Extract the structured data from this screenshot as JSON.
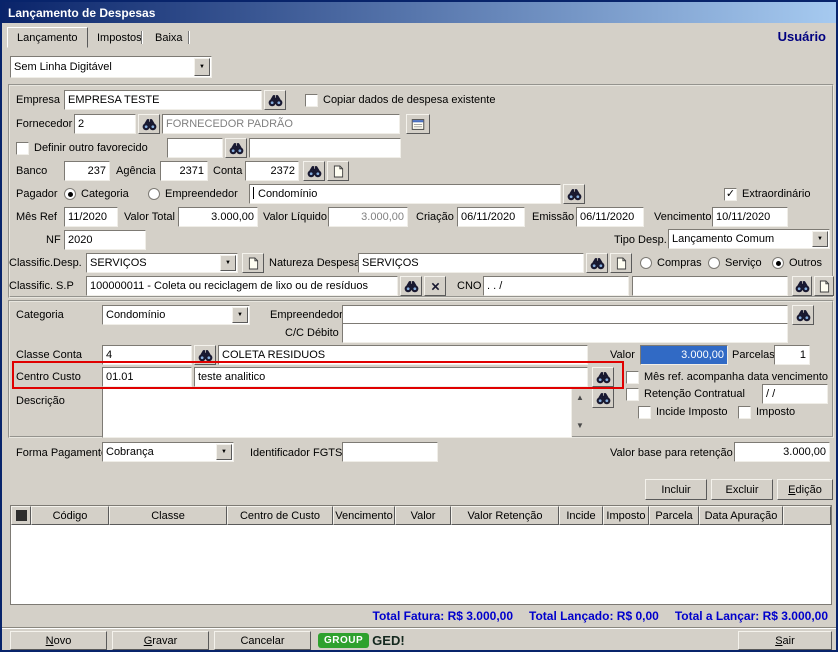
{
  "window": {
    "title": "Lançamento de Despesas",
    "user": "Usuário"
  },
  "tabs": {
    "items": [
      {
        "label": "Lançamento",
        "active": true
      },
      {
        "label": "Impostos",
        "active": false
      },
      {
        "label": "Baixa",
        "active": false
      }
    ]
  },
  "toolbar": {
    "linha_digitavel": "Sem Linha Digitável"
  },
  "form": {
    "empresa": {
      "label": "Empresa",
      "value": "EMPRESA TESTE"
    },
    "copiar": {
      "label": "Copiar dados de despesa existente",
      "checked": false
    },
    "fornecedor": {
      "label": "Fornecedor",
      "code": "2",
      "name": "FORNECEDOR PADRÃO"
    },
    "favorecido": {
      "label": "Definir outro favorecido",
      "checked": false,
      "code": "",
      "name": ""
    },
    "banco": {
      "label": "Banco",
      "value": "237"
    },
    "agencia": {
      "label": "Agência",
      "value": "2371"
    },
    "conta": {
      "label": "Conta",
      "value": "2372"
    },
    "pagador": {
      "label": "Pagador",
      "option_categoria": "Categoria",
      "option_empreendedor": "Empreendedor",
      "categoria_selected": true,
      "empreendedor_selected": false,
      "value": "Condomínio"
    },
    "extraordinario": {
      "label": "Extraordinário",
      "checked": true
    },
    "mes_ref": {
      "label": "Mês Ref",
      "value": "11/2020"
    },
    "valor_total": {
      "label": "Valor Total",
      "value": "3.000,00"
    },
    "valor_liquido": {
      "label": "Valor Líquido",
      "value": "3.000,00"
    },
    "criacao": {
      "label": "Criação",
      "value": "06/11/2020"
    },
    "emissao": {
      "label": "Emissão",
      "value": "06/11/2020"
    },
    "vencimento": {
      "label": "Vencimento",
      "value": "10/11/2020"
    },
    "nf": {
      "label": "NF",
      "value": "2020"
    },
    "tipo_desp": {
      "label": "Tipo Desp.",
      "value": "Lançamento Comum"
    },
    "classific_desp": {
      "label": "Classific.Desp.",
      "value": "SERVIÇOS"
    },
    "natureza": {
      "label": "Natureza Despesa",
      "value": "SERVIÇOS",
      "option_compras": "Compras",
      "option_servico": "Serviço",
      "option_outros": "Outros",
      "compras_selected": false,
      "servico_selected": false,
      "outros_selected": true
    },
    "classific_sp": {
      "label": "Classific. S.P",
      "value": "100000011 - Coleta ou reciclagem de lixo ou de resíduos"
    },
    "cno": {
      "label": "CNO",
      "value": ".   .      /",
      "aux": ""
    },
    "categoria": {
      "label": "Categoria",
      "value": "Condomínio"
    },
    "empreendedor": {
      "label": "Empreendedor",
      "value": ""
    },
    "cc_debito": {
      "label": "C/C Débito",
      "value": ""
    },
    "classe_conta": {
      "label": "Classe Conta",
      "code": "4",
      "name": "COLETA RESIDUOS"
    },
    "valor": {
      "label": "Valor",
      "value": "3.000,00"
    },
    "parcelas": {
      "label": "Parcelas",
      "value": "1"
    },
    "centro_custo": {
      "label": "Centro Custo",
      "code": "01.01",
      "name": "teste analitico"
    },
    "mes_acompanha": {
      "label": "Mês ref. acompanha data vencimento",
      "checked": false
    },
    "descricao": {
      "label": "Descrição",
      "value": ""
    },
    "retencao": {
      "label": "Retenção Contratual",
      "checked": false,
      "date": "/  /"
    },
    "incide_imposto": {
      "label": "Incide Imposto",
      "checked": false
    },
    "imposto": {
      "label": "Imposto",
      "checked": false
    },
    "forma_pagamento": {
      "label": "Forma Pagamento",
      "value": "Cobrança"
    },
    "fgts": {
      "label": "Identificador FGTS",
      "value": ""
    },
    "valor_base": {
      "label": "Valor base para retenção",
      "value": "3.000,00"
    }
  },
  "actions": {
    "incluir": "Incluir",
    "excluir": "Excluir",
    "edicao": "Edição"
  },
  "grid": {
    "columns": [
      "",
      "Código",
      "Classe",
      "Centro de Custo",
      "Vencimento",
      "Valor",
      "Valor Retenção",
      "Incide",
      "Imposto",
      "Parcela",
      "Data Apuração"
    ]
  },
  "totals": {
    "fatura": "Total Fatura: R$ 3.000,00",
    "lancado": "Total Lançado: R$ 0,00",
    "a_lancar": "Total a Lançar: R$ 3.000,00"
  },
  "footer": {
    "novo": "Novo",
    "gravar": "Gravar",
    "cancelar": "Cancelar",
    "sair": "Sair",
    "ged_group": "GROUP",
    "ged_name": "GED!"
  },
  "colors": {
    "titlebar-start": "#0a246a",
    "titlebar-end": "#a6caf0",
    "selection": "#316ac5",
    "totals-blue": "#0000cc",
    "annotation-red": "#e00000",
    "ged-green": "#2ea12e",
    "user-navy": "#000080"
  }
}
